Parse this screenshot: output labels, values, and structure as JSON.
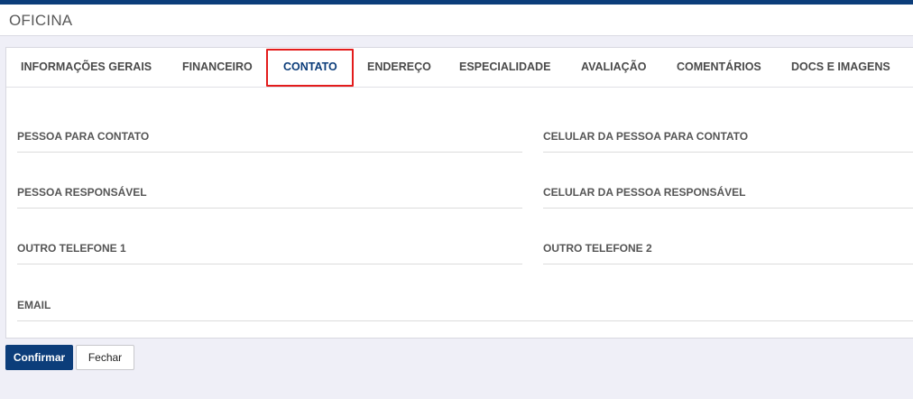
{
  "window": {
    "title": "OFICINA"
  },
  "tabs": [
    {
      "label": "INFORMAÇÕES GERAIS",
      "active": false
    },
    {
      "label": "FINANCEIRO",
      "active": false
    },
    {
      "label": "CONTATO",
      "active": true
    },
    {
      "label": "ENDEREÇO",
      "active": false
    },
    {
      "label": "ESPECIALIDADE",
      "active": false
    },
    {
      "label": "AVALIAÇÃO",
      "active": false
    },
    {
      "label": "COMENTÁRIOS",
      "active": false
    },
    {
      "label": "DOCS E IMAGENS",
      "active": false
    }
  ],
  "form": {
    "contact_person": {
      "label": "PESSOA PARA CONTATO",
      "value": ""
    },
    "contact_person_mobile": {
      "label": "CELULAR DA PESSOA PARA CONTATO",
      "value": ""
    },
    "responsible_person": {
      "label": "PESSOA RESPONSÁVEL",
      "value": ""
    },
    "responsible_person_mobile": {
      "label": "CELULAR DA PESSOA RESPONSÁVEL",
      "value": ""
    },
    "other_phone_1": {
      "label": "OUTRO TELEFONE 1",
      "value": ""
    },
    "other_phone_2": {
      "label": "OUTRO TELEFONE 2",
      "value": ""
    },
    "email": {
      "label": "EMAIL",
      "value": ""
    }
  },
  "actions": {
    "confirm_label": "Confirmar",
    "close_label": "Fechar"
  },
  "colors": {
    "brand": "#0c3d7a",
    "highlight": "#e31c1c",
    "background": "#efeff7"
  }
}
